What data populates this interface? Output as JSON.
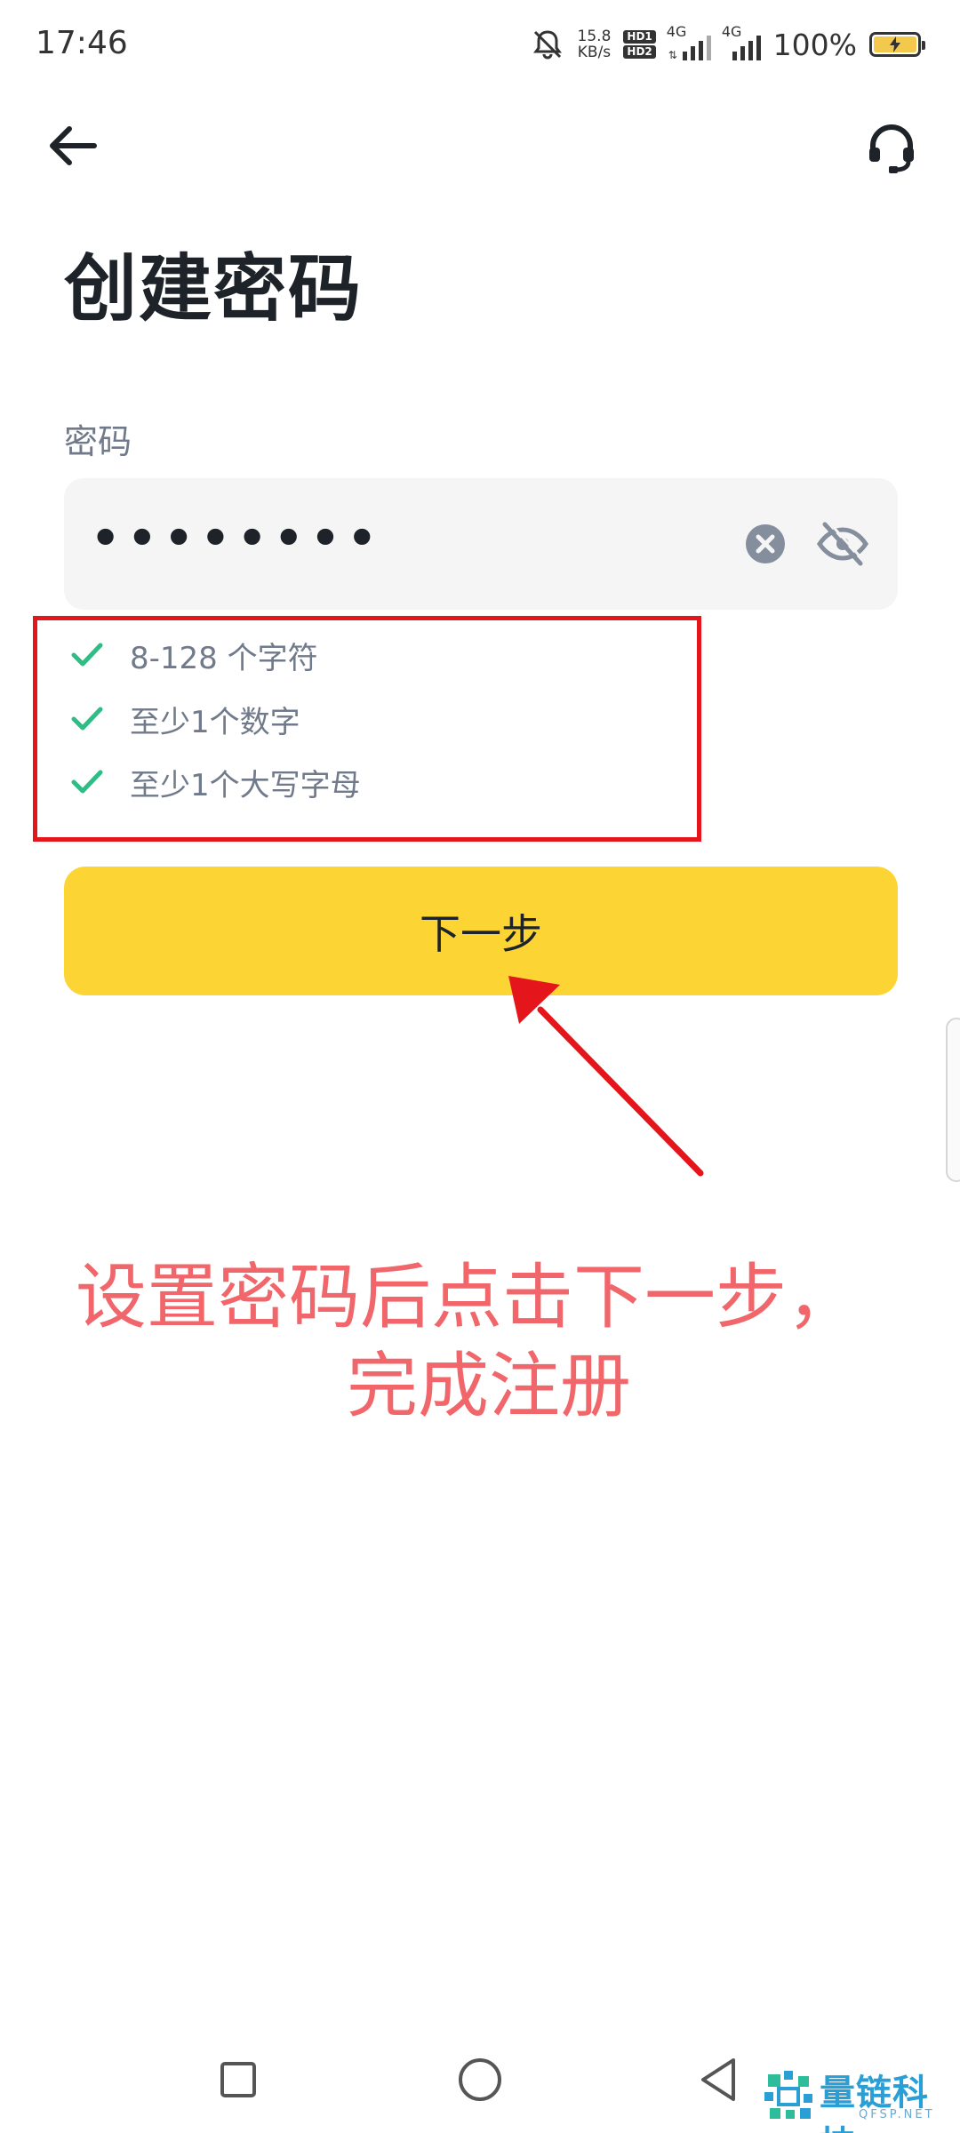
{
  "status_bar": {
    "time": "17:46",
    "net_speed_value": "15.8",
    "net_speed_unit": "KB/s",
    "hd1": "HD1",
    "hd2": "HD2",
    "signal_1": "4G",
    "signal_2": "4G",
    "battery_percent": "100%",
    "icons": [
      "bell-muted-icon",
      "signal-icon",
      "battery-charging-icon"
    ]
  },
  "header": {
    "back_icon": "arrow-left-icon",
    "support_icon": "headset-icon",
    "title": "创建密码"
  },
  "password": {
    "label": "密码",
    "masked_value": "••••••••",
    "clear_icon": "clear-circle-icon",
    "visibility_icon": "eye-off-icon"
  },
  "rules": [
    {
      "text": "8-128 个字符",
      "met": true
    },
    {
      "text": "至少1个数字",
      "met": true
    },
    {
      "text": "至少1个大写字母",
      "met": true
    }
  ],
  "next_button": {
    "label": "下一步"
  },
  "annotation": {
    "line1": "设置密码后点击下一步，",
    "line2": "完成注册"
  },
  "watermark": {
    "name": "量链科技",
    "sub": "QFSP.NET"
  },
  "colors": {
    "primary": "#FCD535",
    "check": "#2EBD85",
    "highlight_box": "#E4161B",
    "annotation": "#F0666A"
  }
}
